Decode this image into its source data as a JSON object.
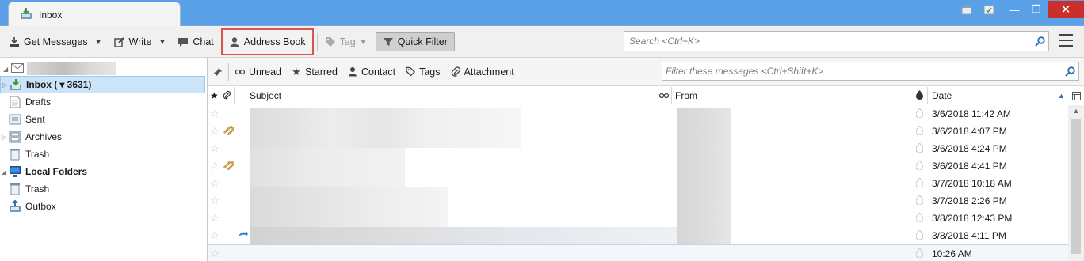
{
  "tab": {
    "label": "Inbox"
  },
  "window_controls": {
    "minimize": "—",
    "restore": "❐",
    "close": "✕"
  },
  "toolbar": {
    "get_messages": "Get Messages",
    "write": "Write",
    "chat": "Chat",
    "address_book": "Address Book",
    "tag": "Tag",
    "quick_filter": "Quick Filter",
    "search_placeholder": "Search <Ctrl+K>"
  },
  "folders": {
    "inbox_label": "Inbox (",
    "inbox_count": "▾ 3631)",
    "drafts": "Drafts",
    "sent": "Sent",
    "archives": "Archives",
    "trash": "Trash",
    "local_folders": "Local Folders",
    "local_trash": "Trash",
    "outbox": "Outbox"
  },
  "quickfilter": {
    "unread": "Unread",
    "starred": "Starred",
    "contact": "Contact",
    "tags": "Tags",
    "attachment": "Attachment",
    "filter_placeholder": "Filter these messages <Ctrl+Shift+K>"
  },
  "columns": {
    "subject": "Subject",
    "from": "From",
    "date": "Date"
  },
  "messages": [
    {
      "date": "3/6/2018 11:42 AM",
      "attachment": false,
      "replied": false
    },
    {
      "date": "3/6/2018 4:07 PM",
      "attachment": true,
      "replied": false
    },
    {
      "date": "3/6/2018 4:24 PM",
      "attachment": false,
      "replied": false
    },
    {
      "date": "3/6/2018 4:41 PM",
      "attachment": true,
      "replied": false
    },
    {
      "date": "3/7/2018 10:18 AM",
      "attachment": false,
      "replied": false
    },
    {
      "date": "3/7/2018 2:26 PM",
      "attachment": false,
      "replied": false
    },
    {
      "date": "3/8/2018 12:43 PM",
      "attachment": false,
      "replied": false
    },
    {
      "date": "3/8/2018 4:11 PM",
      "attachment": false,
      "replied": true
    },
    {
      "date": "10:26 AM",
      "attachment": false,
      "replied": false
    }
  ],
  "colors": {
    "titlebar": "#5aa0e6",
    "selection": "#cce4f7",
    "highlight_border": "#d9534f"
  }
}
